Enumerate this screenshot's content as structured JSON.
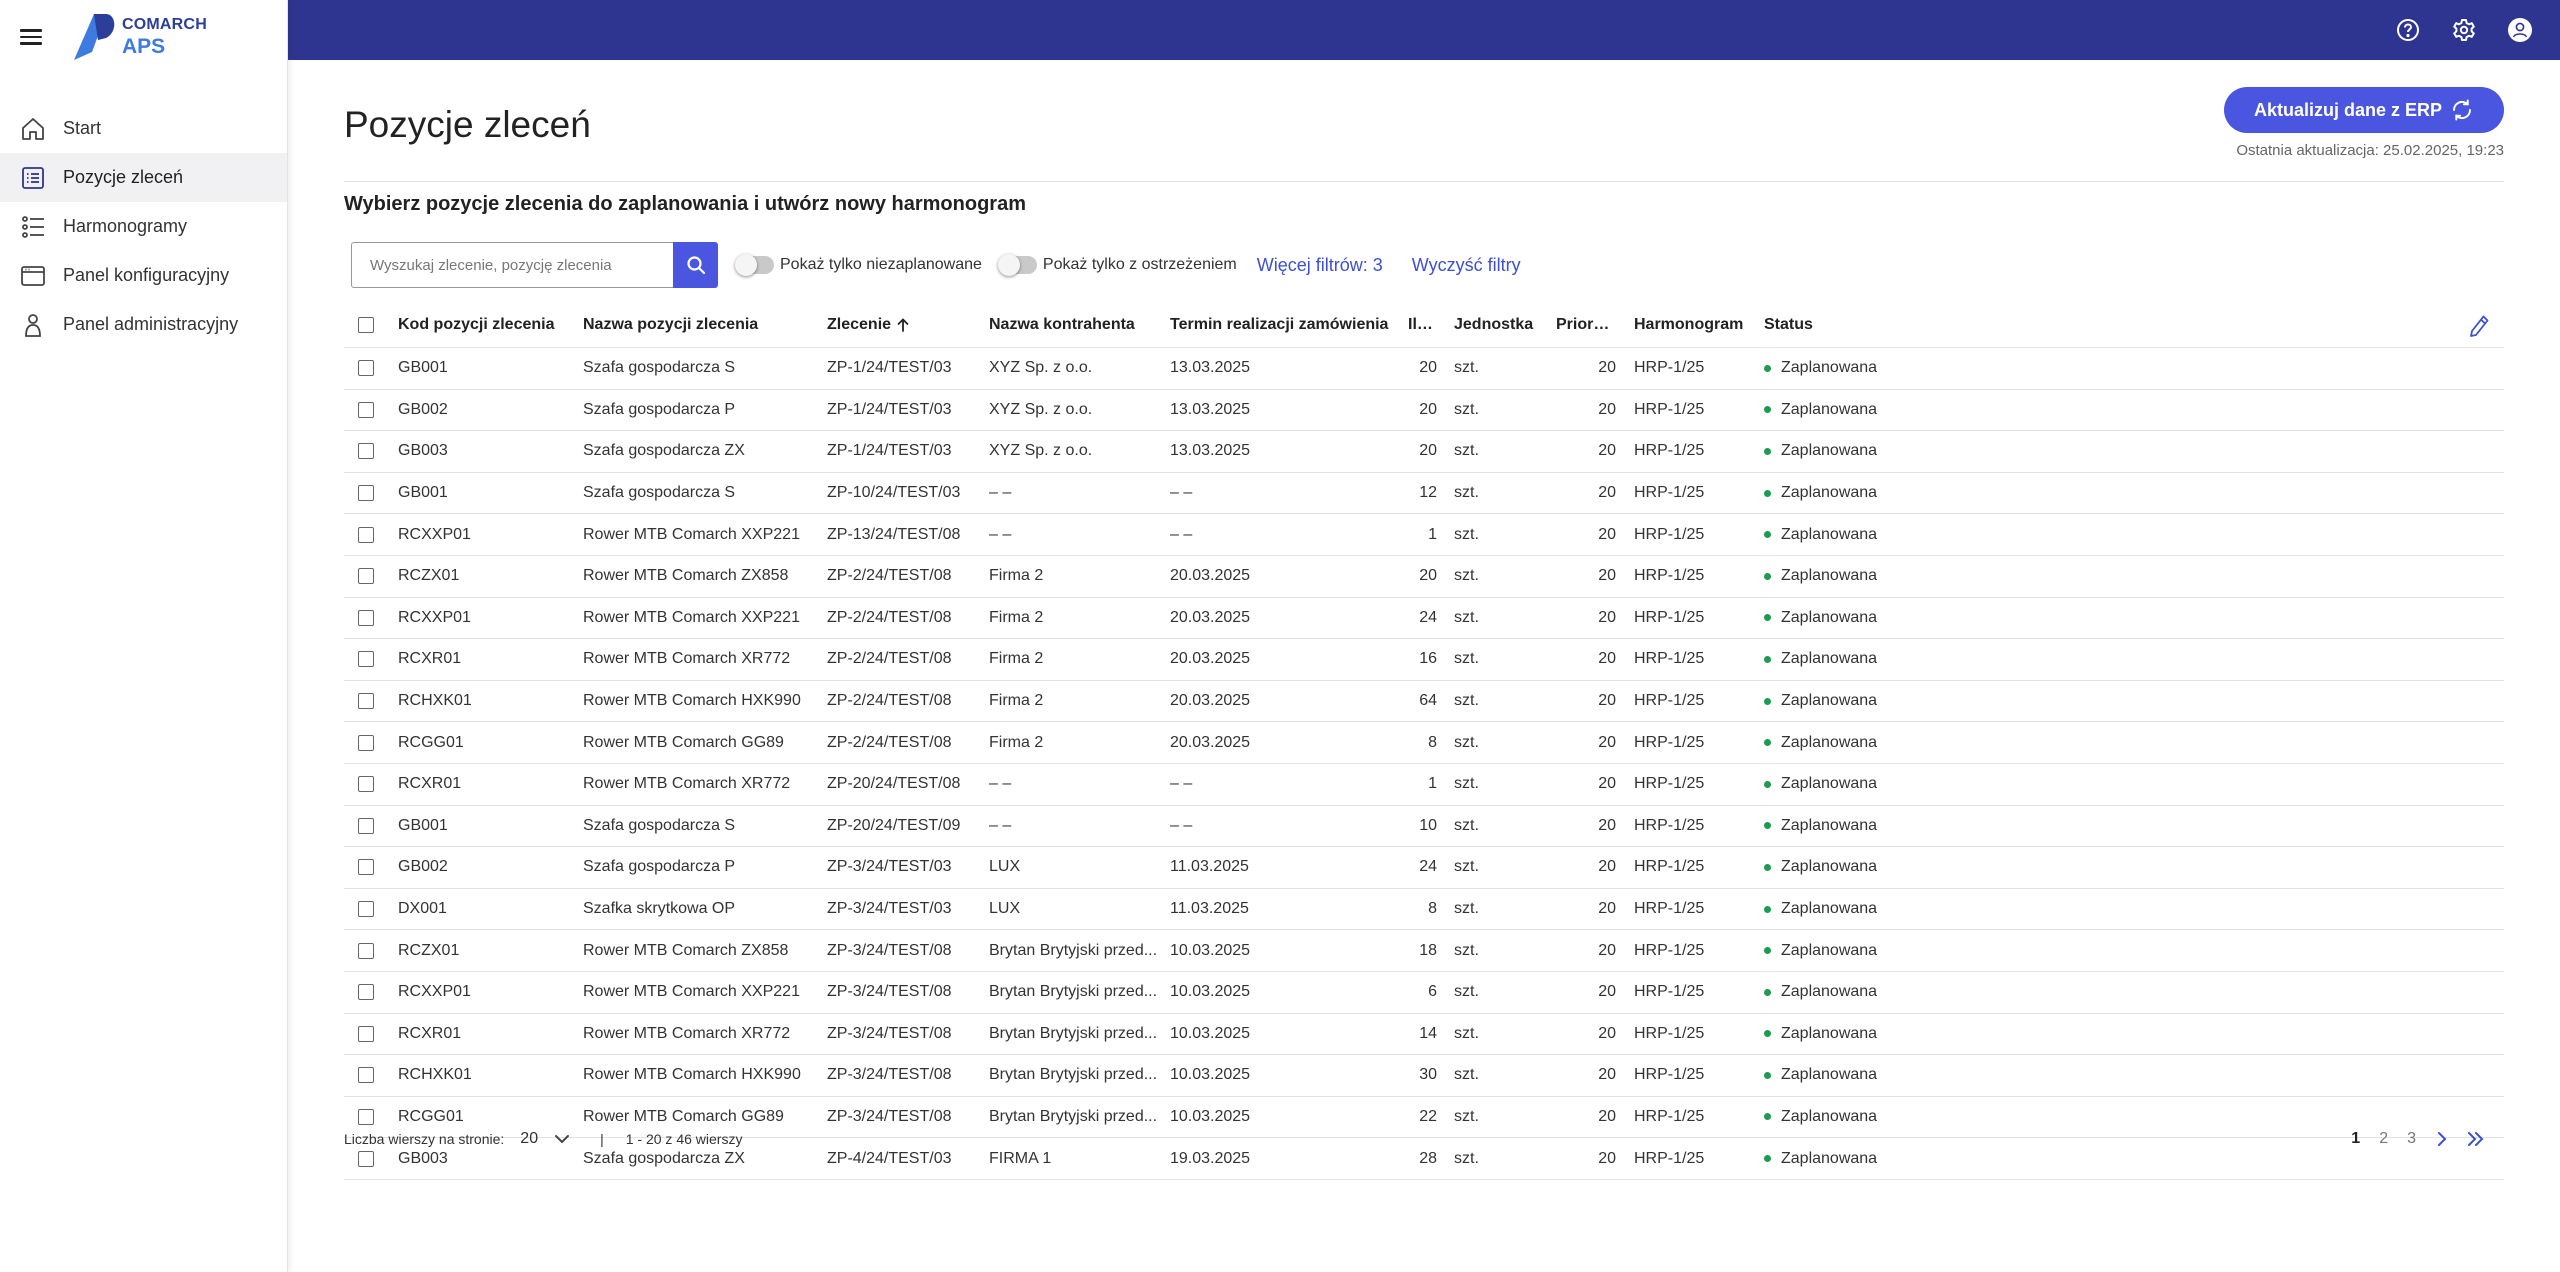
{
  "app": {
    "logo_brand": "COMARCH",
    "logo_app": "APS",
    "brand_color": "#2e3590",
    "accent_color": "#4a55e0"
  },
  "sidebar": {
    "items": [
      {
        "label": "Start",
        "icon": "home-icon",
        "active": false
      },
      {
        "label": "Pozycje zleceń",
        "icon": "list-icon",
        "active": true
      },
      {
        "label": "Harmonogramy",
        "icon": "schedule-list-icon",
        "active": false
      },
      {
        "label": "Panel konfiguracyjny",
        "icon": "window-icon",
        "active": false
      },
      {
        "label": "Panel administracyjny",
        "icon": "person-icon",
        "active": false
      }
    ]
  },
  "topbar": {
    "icons": [
      "help-icon",
      "settings-icon",
      "account-icon"
    ]
  },
  "page": {
    "title": "Pozycje zleceń",
    "erp_button": "Aktualizuj dane z ERP",
    "last_update": "Ostatnia aktualizacja: 25.02.2025, 19:23",
    "subtitle": "Wybierz pozycje zlecenia do zaplanowania i utwórz nowy harmonogram"
  },
  "filters": {
    "search_placeholder": "Wyszukaj zlecenie, pozycję zlecenia",
    "toggle_unplanned": "Pokaż tylko niezaplanowane",
    "toggle_warning": "Pokaż tylko z ostrzeżeniem",
    "more_filters": "Więcej filtrów: 3",
    "clear_filters": "Wyczyść filtry"
  },
  "table": {
    "columns": [
      "Kod pozycji zlecenia",
      "Nazwa pozycji zlecenia",
      "Zlecenie",
      "Nazwa kontrahenta",
      "Termin realizacji zamówienia",
      "Ilość",
      "Jednostka",
      "Priorytet",
      "Harmonogram",
      "Status"
    ],
    "sorted_column": "Zlecenie",
    "sort_direction": "ascending",
    "status_color": "#1b9d4f",
    "rows": [
      {
        "code": "GB001",
        "name": "Szafa gospodarcza S",
        "order": "ZP-1/24/TEST/03",
        "contractor": "XYZ Sp. z o.o.",
        "deadline": "13.03.2025",
        "qty": "20",
        "unit": "szt.",
        "priority": "20",
        "schedule": "HRP-1/25",
        "status": "Zaplanowana"
      },
      {
        "code": "GB002",
        "name": "Szafa gospodarcza P",
        "order": "ZP-1/24/TEST/03",
        "contractor": "XYZ Sp. z o.o.",
        "deadline": "13.03.2025",
        "qty": "20",
        "unit": "szt.",
        "priority": "20",
        "schedule": "HRP-1/25",
        "status": "Zaplanowana"
      },
      {
        "code": "GB003",
        "name": "Szafa gospodarcza ZX",
        "order": "ZP-1/24/TEST/03",
        "contractor": "XYZ Sp. z o.o.",
        "deadline": "13.03.2025",
        "qty": "20",
        "unit": "szt.",
        "priority": "20",
        "schedule": "HRP-1/25",
        "status": "Zaplanowana"
      },
      {
        "code": "GB001",
        "name": "Szafa gospodarcza S",
        "order": "ZP-10/24/TEST/03",
        "contractor": "– –",
        "deadline": "– –",
        "qty": "12",
        "unit": "szt.",
        "priority": "20",
        "schedule": "HRP-1/25",
        "status": "Zaplanowana"
      },
      {
        "code": "RCXXP01",
        "name": "Rower MTB Comarch XXP221",
        "order": "ZP-13/24/TEST/08",
        "contractor": "– –",
        "deadline": "– –",
        "qty": "1",
        "unit": "szt.",
        "priority": "20",
        "schedule": "HRP-1/25",
        "status": "Zaplanowana"
      },
      {
        "code": "RCZX01",
        "name": "Rower MTB Comarch ZX858",
        "order": "ZP-2/24/TEST/08",
        "contractor": "Firma 2",
        "deadline": "20.03.2025",
        "qty": "20",
        "unit": "szt.",
        "priority": "20",
        "schedule": "HRP-1/25",
        "status": "Zaplanowana"
      },
      {
        "code": "RCXXP01",
        "name": "Rower MTB Comarch XXP221",
        "order": "ZP-2/24/TEST/08",
        "contractor": "Firma 2",
        "deadline": "20.03.2025",
        "qty": "24",
        "unit": "szt.",
        "priority": "20",
        "schedule": "HRP-1/25",
        "status": "Zaplanowana"
      },
      {
        "code": "RCXR01",
        "name": "Rower MTB Comarch XR772",
        "order": "ZP-2/24/TEST/08",
        "contractor": "Firma 2",
        "deadline": "20.03.2025",
        "qty": "16",
        "unit": "szt.",
        "priority": "20",
        "schedule": "HRP-1/25",
        "status": "Zaplanowana"
      },
      {
        "code": "RCHXK01",
        "name": "Rower MTB Comarch HXK990",
        "order": "ZP-2/24/TEST/08",
        "contractor": "Firma 2",
        "deadline": "20.03.2025",
        "qty": "64",
        "unit": "szt.",
        "priority": "20",
        "schedule": "HRP-1/25",
        "status": "Zaplanowana"
      },
      {
        "code": "RCGG01",
        "name": "Rower MTB Comarch GG89",
        "order": "ZP-2/24/TEST/08",
        "contractor": "Firma 2",
        "deadline": "20.03.2025",
        "qty": "8",
        "unit": "szt.",
        "priority": "20",
        "schedule": "HRP-1/25",
        "status": "Zaplanowana"
      },
      {
        "code": "RCXR01",
        "name": "Rower MTB Comarch XR772",
        "order": "ZP-20/24/TEST/08",
        "contractor": "– –",
        "deadline": "– –",
        "qty": "1",
        "unit": "szt.",
        "priority": "20",
        "schedule": "HRP-1/25",
        "status": "Zaplanowana"
      },
      {
        "code": "GB001",
        "name": "Szafa gospodarcza S",
        "order": "ZP-20/24/TEST/09",
        "contractor": "– –",
        "deadline": "– –",
        "qty": "10",
        "unit": "szt.",
        "priority": "20",
        "schedule": "HRP-1/25",
        "status": "Zaplanowana"
      },
      {
        "code": "GB002",
        "name": "Szafa gospodarcza P",
        "order": "ZP-3/24/TEST/03",
        "contractor": "LUX",
        "deadline": "11.03.2025",
        "qty": "24",
        "unit": "szt.",
        "priority": "20",
        "schedule": "HRP-1/25",
        "status": "Zaplanowana"
      },
      {
        "code": "DX001",
        "name": "Szafka skrytkowa OP",
        "order": "ZP-3/24/TEST/03",
        "contractor": "LUX",
        "deadline": "11.03.2025",
        "qty": "8",
        "unit": "szt.",
        "priority": "20",
        "schedule": "HRP-1/25",
        "status": "Zaplanowana"
      },
      {
        "code": "RCZX01",
        "name": "Rower MTB Comarch ZX858",
        "order": "ZP-3/24/TEST/08",
        "contractor": "Brytan Brytyjski przed...",
        "deadline": "10.03.2025",
        "qty": "18",
        "unit": "szt.",
        "priority": "20",
        "schedule": "HRP-1/25",
        "status": "Zaplanowana"
      },
      {
        "code": "RCXXP01",
        "name": "Rower MTB Comarch XXP221",
        "order": "ZP-3/24/TEST/08",
        "contractor": "Brytan Brytyjski przed...",
        "deadline": "10.03.2025",
        "qty": "6",
        "unit": "szt.",
        "priority": "20",
        "schedule": "HRP-1/25",
        "status": "Zaplanowana"
      },
      {
        "code": "RCXR01",
        "name": "Rower MTB Comarch XR772",
        "order": "ZP-3/24/TEST/08",
        "contractor": "Brytan Brytyjski przed...",
        "deadline": "10.03.2025",
        "qty": "14",
        "unit": "szt.",
        "priority": "20",
        "schedule": "HRP-1/25",
        "status": "Zaplanowana"
      },
      {
        "code": "RCHXK01",
        "name": "Rower MTB Comarch HXK990",
        "order": "ZP-3/24/TEST/08",
        "contractor": "Brytan Brytyjski przed...",
        "deadline": "10.03.2025",
        "qty": "30",
        "unit": "szt.",
        "priority": "20",
        "schedule": "HRP-1/25",
        "status": "Zaplanowana"
      },
      {
        "code": "RCGG01",
        "name": "Rower MTB Comarch GG89",
        "order": "ZP-3/24/TEST/08",
        "contractor": "Brytan Brytyjski przed...",
        "deadline": "10.03.2025",
        "qty": "22",
        "unit": "szt.",
        "priority": "20",
        "schedule": "HRP-1/25",
        "status": "Zaplanowana"
      },
      {
        "code": "GB003",
        "name": "Szafa gospodarcza ZX",
        "order": "ZP-4/24/TEST/03",
        "contractor": "FIRMA 1",
        "deadline": "19.03.2025",
        "qty": "28",
        "unit": "szt.",
        "priority": "20",
        "schedule": "HRP-1/25",
        "status": "Zaplanowana"
      }
    ]
  },
  "pagination": {
    "rows_per_page_label": "Liczba wierszy na stronie:",
    "rows_per_page": "20",
    "separator": "|",
    "range": "1 - 20 z 46 wierszy",
    "pages": [
      "1",
      "2",
      "3"
    ],
    "current_page": "1"
  }
}
